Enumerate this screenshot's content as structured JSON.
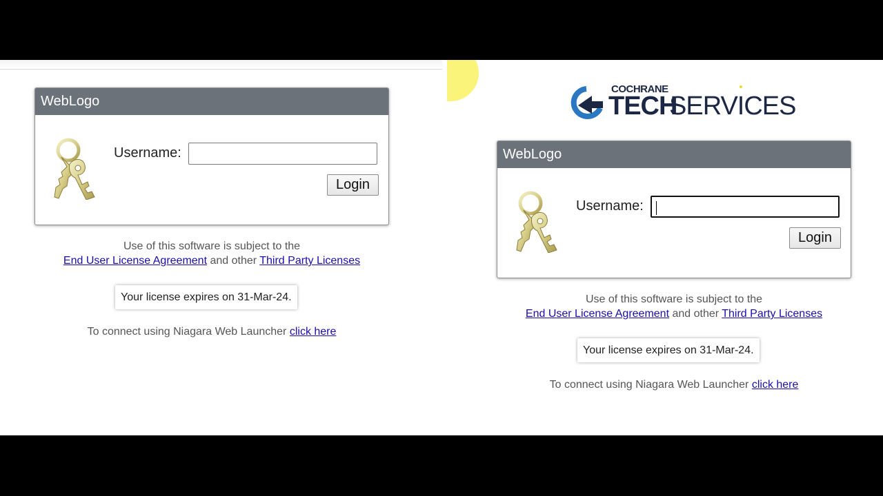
{
  "left": {
    "panel_title": "WebLogo",
    "username_label": "Username:",
    "username_value": "",
    "login_label": "Login",
    "notice_line1": "Use of this software is subject to the",
    "eula_link": "End User License Agreement",
    "and_other": "and other",
    "third_party_link": "Third Party Licenses",
    "license_text": "Your license expires on 31-Mar-24.",
    "launcher_text": "To connect using Niagara Web Launcher",
    "launcher_link": "click here"
  },
  "right": {
    "logo_top": "COCHRANE",
    "logo_tech": "TECH",
    "logo_services": "SERVICES",
    "panel_title": "WebLogo",
    "username_label": "Username:",
    "username_value": "",
    "login_label": "Login",
    "notice_line1": "Use of this software is subject to the",
    "eula_link": "End User License Agreement",
    "and_other": "and other",
    "third_party_link": "Third Party Licenses",
    "license_text": "Your license expires on 31-Mar-24.",
    "launcher_text": "To connect using Niagara Web Launcher",
    "launcher_link": "click here"
  },
  "colors": {
    "panel_header": "#6c727a",
    "link": "#1a0dab",
    "logo_navy": "#1c2743",
    "logo_blue": "#2b78c2",
    "cursor_highlight": "#fbf47a"
  },
  "icons": [
    "keys-icon",
    "cochrane-logo-mark"
  ]
}
